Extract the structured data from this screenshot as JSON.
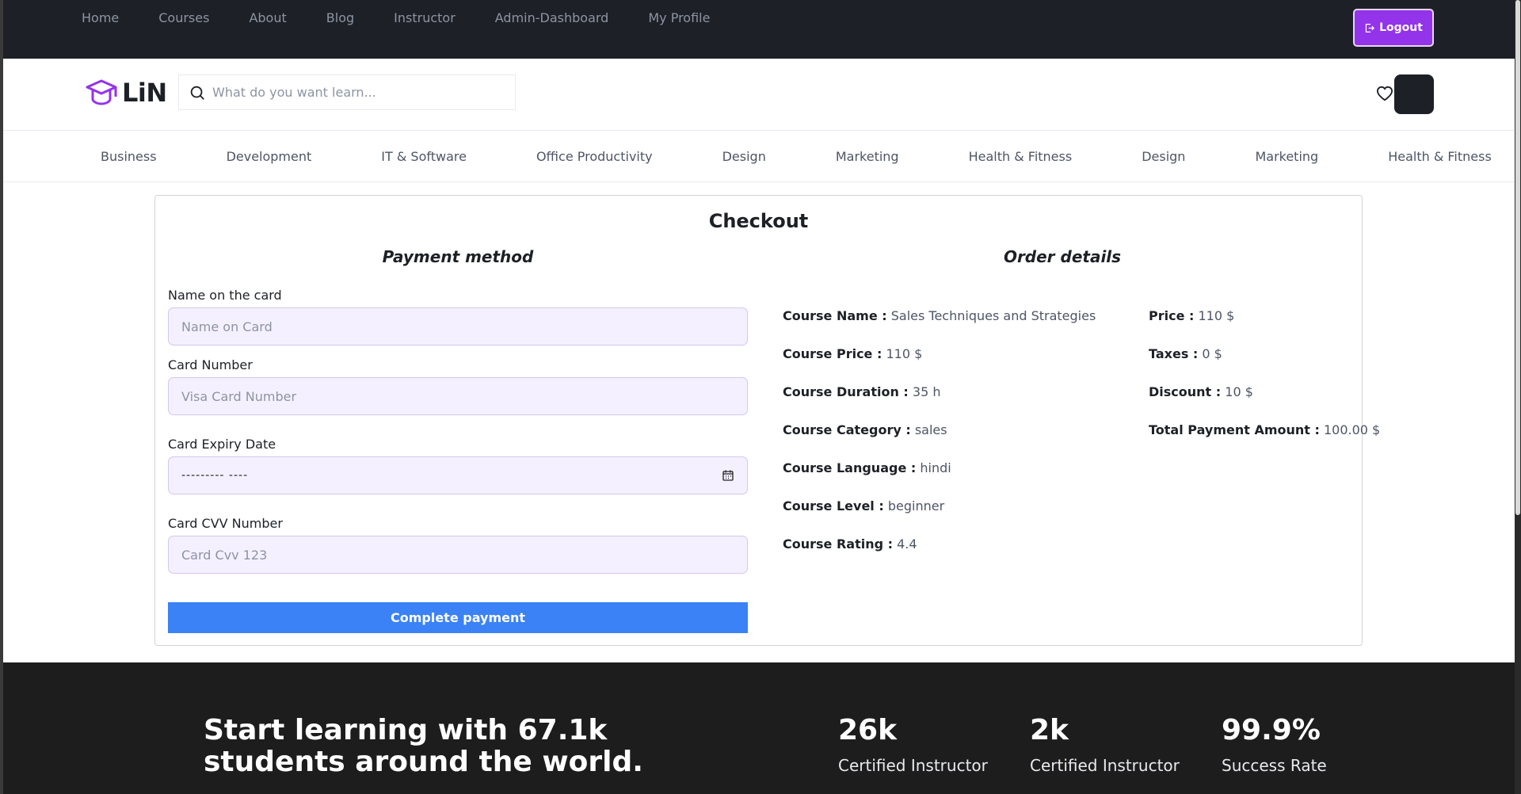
{
  "topnav": {
    "items": [
      "Home",
      "Courses",
      "About",
      "Blog",
      "Instructor",
      "Admin-Dashboard",
      "My Profile"
    ],
    "logout_label": "Logout"
  },
  "header": {
    "logo_text": "LiN",
    "search_placeholder": "What do you want learn..."
  },
  "categories": [
    "Business",
    "Development",
    "IT & Software",
    "Office Productivity",
    "Design",
    "Marketing",
    "Health & Fitness",
    "Design",
    "Marketing",
    "Health & Fitness"
  ],
  "checkout": {
    "title": "Checkout",
    "payment_title": "Payment method",
    "order_title": "Order details",
    "form": {
      "name_label": "Name on the card",
      "name_placeholder": "Name on Card",
      "number_label": "Card Number",
      "number_placeholder": "Visa Card Number",
      "expiry_label": "Card Expiry Date",
      "expiry_value": "--------- ----",
      "cvv_label": "Card CVV Number",
      "cvv_placeholder": "Card Cvv 123",
      "submit_label": "Complete payment"
    },
    "course_details": [
      {
        "label": "Course Name :",
        "value": "Sales Techniques and Strategies"
      },
      {
        "label": "Course Price :",
        "value": "110 $"
      },
      {
        "label": "Course Duration :",
        "value": "35 h"
      },
      {
        "label": "Course Category :",
        "value": "sales"
      },
      {
        "label": "Course Language :",
        "value": "hindi"
      },
      {
        "label": "Course Level :",
        "value": "beginner"
      },
      {
        "label": "Course Rating :",
        "value": "4.4"
      }
    ],
    "payment_details": [
      {
        "label": "Price :",
        "value": "110 $"
      },
      {
        "label": "Taxes :",
        "value": "0 $"
      },
      {
        "label": "Discount :",
        "value": "10 $"
      },
      {
        "label": "Total Payment Amount :",
        "value": "100.00 $"
      }
    ]
  },
  "footer": {
    "headline": "Start learning with 67.1k students around the world.",
    "stats": [
      {
        "num": "26k",
        "label": "Certified Instructor"
      },
      {
        "num": "2k",
        "label": "Certified Instructor"
      },
      {
        "num": "99.9%",
        "label": "Success Rate"
      }
    ]
  },
  "colors": {
    "accent": "#9333ea",
    "primary_button": "#3b82f6",
    "dark": "#1d2026"
  }
}
